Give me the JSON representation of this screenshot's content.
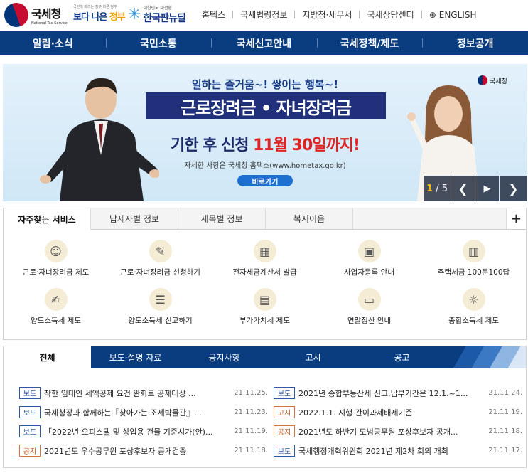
{
  "header": {
    "logo_kr": "국세청",
    "logo_en": "National Tax Service",
    "gov_small": "국민이 바라는 정부 바른 정부",
    "gov_big_a": "보다 나은",
    "gov_big_b": "정부",
    "kr_small": "대한민국 대전환",
    "kr_big": "한국판뉴딜",
    "links": [
      "홈텍스",
      "국세법령정보",
      "지방청·세무서",
      "국세상담센터"
    ],
    "english": "ENGLISH"
  },
  "gnb": [
    "알림·소식",
    "국민소통",
    "국세신고안내",
    "국세정책/제도",
    "정보공개"
  ],
  "banner": {
    "catch": "일하는 즐거움~! 쌓이는 행복~!",
    "title": "근로장려금 • 자녀장려금",
    "deadline_a": "기한 후 신청 ",
    "deadline_b": "11월 30일까지!",
    "info": "자세한 사항은 국세청 홈택스(www.hometax.go.kr)",
    "button": "바로가기",
    "mark": "국세청",
    "page_current": "1",
    "page_total": "/ 5"
  },
  "services": {
    "tabs": [
      "자주찾는 서비스",
      "납세자별 정보",
      "세목별 정보",
      "복지이음"
    ],
    "plus": "+",
    "items": [
      {
        "label": "근로·자녀장려금 제도",
        "icon": "person-coin-icon"
      },
      {
        "label": "근로·자녀장려금 신청하기",
        "icon": "document-pen-icon"
      },
      {
        "label": "전자세금계산서 발급",
        "icon": "calculator-icon"
      },
      {
        "label": "사업자등록 안내",
        "icon": "id-card-icon"
      },
      {
        "label": "주택세금 100문100답",
        "icon": "building-icon"
      },
      {
        "label": "양도소득세 제도",
        "icon": "transfer-document-icon"
      },
      {
        "label": "양도소득세 신고하기",
        "icon": "report-document-icon"
      },
      {
        "label": "부가가치세 제도",
        "icon": "book-icon"
      },
      {
        "label": "연말정산 안내",
        "icon": "monitor-icon"
      },
      {
        "label": "종합소득세 제도",
        "icon": "person-bulb-icon"
      }
    ]
  },
  "news": {
    "tabs": [
      "전체",
      "보도·설명 자료",
      "공지사항",
      "고시",
      "공고"
    ],
    "left": [
      {
        "badge": "보도",
        "title": "착한 임대인 세액공제 요건 완화로 공제대상 ...",
        "date": "21.11.25."
      },
      {
        "badge": "보도",
        "title": "국세청장과 함께하는『찾아가는 조세박물관』...",
        "date": "21.11.23."
      },
      {
        "badge": "보도",
        "title": "「2022년 오피스텔 및 상업용 건물 기준시가(안)...",
        "date": "21.11.19."
      },
      {
        "badge": "공지",
        "title": "2021년도 우수공무원 포상후보자 공개검증",
        "date": "21.11.18."
      }
    ],
    "right": [
      {
        "badge": "보도",
        "title": "2021년 종합부동산세 신고,납부기간은 12.1.~1...",
        "date": "21.11.24."
      },
      {
        "badge": "고시",
        "title": "2022.1.1. 시행 간이과세배제기준",
        "date": "21.11.19."
      },
      {
        "badge": "공지",
        "title": "2021년도 하반기 모범공무원 포상후보자 공개...",
        "date": "21.11.18."
      },
      {
        "badge": "보도",
        "title": "국세행정개혁위원회 2021년 제2차 회의 개최",
        "date": "21.11.17."
      }
    ]
  },
  "colors": {
    "navy": "#0a3d80",
    "accent_red": "#e02424",
    "badge_blue": "#2d5aa6",
    "badge_orange": "#c75a1f"
  }
}
